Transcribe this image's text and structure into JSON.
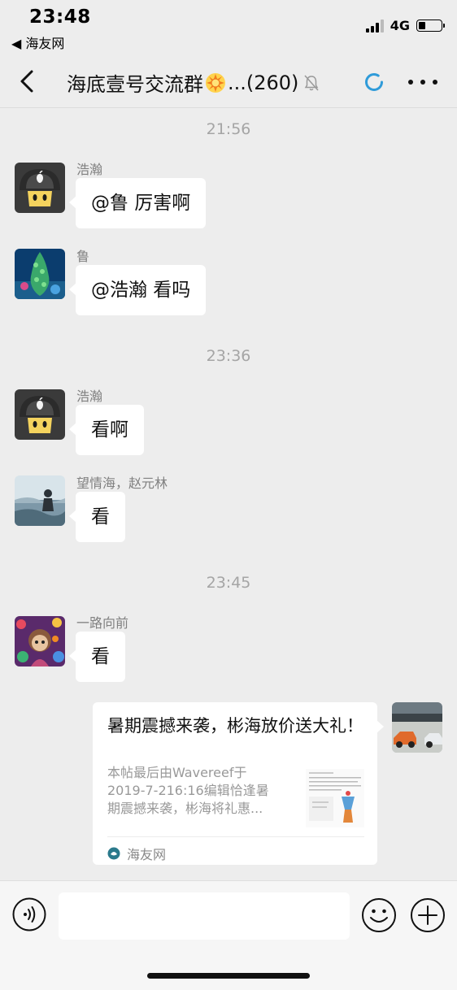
{
  "status_bar": {
    "time": "23:48",
    "back_app": "◀ 海友网",
    "network": "4G",
    "battery_level": 0.25
  },
  "header": {
    "title_prefix": "海底壹号交流群",
    "title_suffix": "...(260)",
    "title_emoji": "sun-emoji"
  },
  "messages": [
    {
      "type": "time",
      "text": "21:56"
    },
    {
      "type": "text",
      "sender": "浩瀚",
      "avatar": "mushroom-apple-avatar",
      "text": "@鲁 厉害啊"
    },
    {
      "type": "text",
      "sender": "鲁",
      "avatar": "coral-avatar",
      "text": "@浩瀚 看吗"
    },
    {
      "type": "time",
      "text": "23:36"
    },
    {
      "type": "text",
      "sender": "浩瀚",
      "avatar": "mushroom-apple-avatar",
      "text": "看啊"
    },
    {
      "type": "text",
      "sender": "望情海，赵元林",
      "avatar": "seascape-avatar",
      "text": "看"
    },
    {
      "type": "time",
      "text": "23:45"
    },
    {
      "type": "text",
      "sender": "一路向前",
      "avatar": "colorful-child-avatar",
      "text": "看"
    },
    {
      "type": "link_card",
      "outgoing": true,
      "avatar": "race-car-avatar",
      "title": "暑期震撼来袭，彬海放价送大礼！",
      "description": "本帖最后由Wavereef于\n2019-7-216:16编辑恰逢暑\n期震撼来袭，彬海将礼惠...",
      "source": "海友网"
    }
  ],
  "input_bar": {
    "placeholder": "",
    "value": ""
  },
  "colors": {
    "background": "#ededed",
    "bubble": "#ffffff",
    "timestamp": "#a5a5a5",
    "accent_ring": "#2f9bd9"
  }
}
